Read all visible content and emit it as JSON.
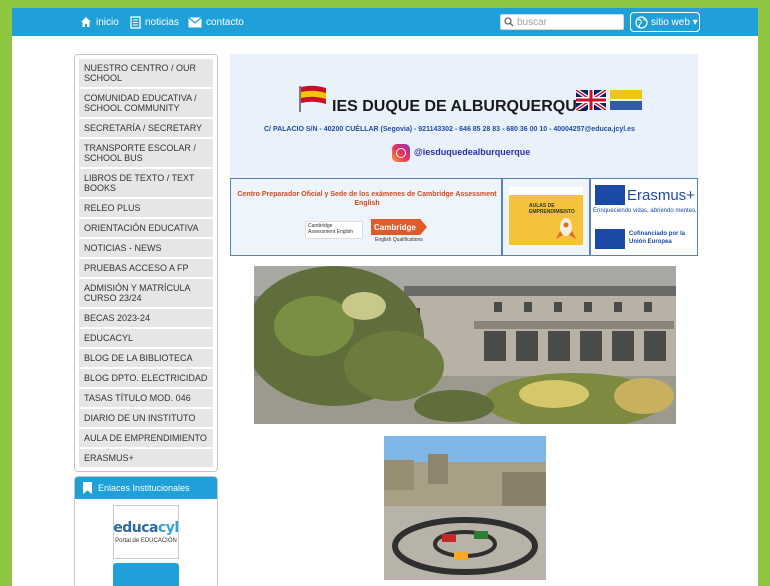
{
  "topbar": {
    "nav": [
      {
        "label": "inicio",
        "icon": "home-icon"
      },
      {
        "label": "noticias",
        "icon": "document-icon"
      },
      {
        "label": "contacto",
        "icon": "mail-icon"
      }
    ],
    "search_placeholder": "buscar",
    "site_label": "sitio web ▾"
  },
  "sidebar": {
    "items": [
      "NUESTRO CENTRO / OUR SCHOOL",
      "COMUNIDAD EDUCATIVA / SCHOOL COMMUNITY",
      "SECRETARÍA / SECRETARY",
      "TRANSPORTE ESCOLAR / SCHOOL BUS",
      "LIBROS DE TEXTO / TEXT BOOKS",
      "RELEO PLUS",
      "ORIENTACIÓN EDUCATIVA",
      "NOTICIAS - NEWS",
      "PRUEBAS ACCESO A FP",
      "ADMISIÓN Y MATRÍCULA CURSO 23/24",
      "BECAS 2023-24",
      "EDUCACYL",
      "BLOG DE LA BIBLIOTECA",
      "BLOG DPTO. ELECTRICIDAD",
      "TASAS TÍTULO MOD. 046",
      "DIARIO DE UN INSTITUTO",
      "AULA DE EMPRENDIMIENTO",
      "ERASMUS+"
    ]
  },
  "links": {
    "title": "Enlaces Institucionales",
    "educacyl_logo_a": "educa",
    "educacyl_logo_b": "cyl",
    "educacyl_sub": "Portal de EDUCACIÓN"
  },
  "banner": {
    "title": "IES DUQUE DE ALBURQUERQUE",
    "address": "C/ PALACIO S/N - 40200 CUÉLLAR (Segovia) - 921143302 - 646 85 28 83 - 680 36 00 10 - 40004257@educa.jcyl.es",
    "instagram": "@iesduquedealburquerque"
  },
  "cambridge": {
    "text": "Centro Preparador Oficial y Sede de los exámenes de Cambridge Assessment English",
    "logo1": "Cambridge Assessment English",
    "logo2": "Cambridge",
    "logo2_sub": "English Qualifications"
  },
  "emprendimiento": {
    "text": "AULAS DE EMPRENDIMIENTO"
  },
  "erasmus": {
    "title": "Erasmus+",
    "subtitle": "Enriqueciendo vidas, abriendo mentes.",
    "cofin": "Cofinanciado por la Unión Europea"
  },
  "colors": {
    "accent": "#1fa0d8",
    "frame": "#8dc63f",
    "sidebar_item_bg": "#e6e6e6"
  }
}
